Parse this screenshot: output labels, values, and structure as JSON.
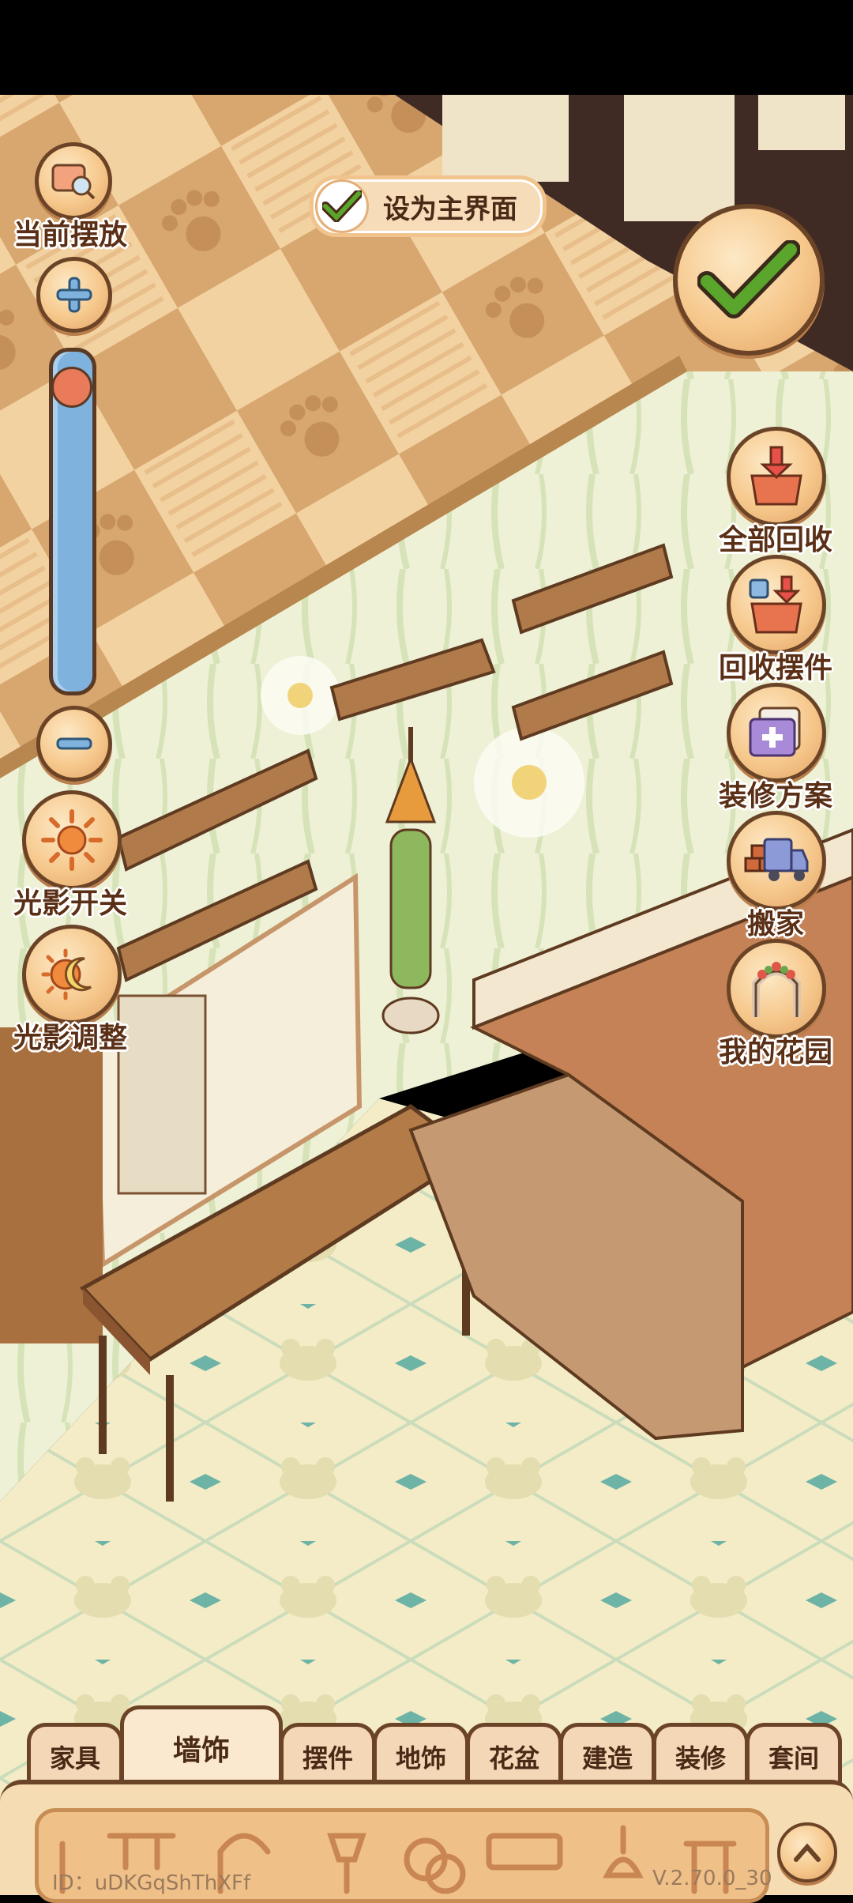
{
  "left_controls": {
    "current_placement_label": "当前摆放",
    "light_toggle_label": "光影开关",
    "light_adjust_label": "光影调整",
    "zoom_level": 0.95
  },
  "set_main_label": "设为主界面",
  "right_controls": {
    "recycle_all_label": "全部回收",
    "recycle_decor_label": "回收摆件",
    "renovation_plan_label": "装修方案",
    "move_label": "搬家",
    "my_garden_label": "我的花园"
  },
  "tabs": [
    {
      "label": "家具",
      "active": false
    },
    {
      "label": "墙饰",
      "active": true
    },
    {
      "label": "摆件",
      "active": false
    },
    {
      "label": "地饰",
      "active": false
    },
    {
      "label": "花盆",
      "active": false
    },
    {
      "label": "建造",
      "active": false
    },
    {
      "label": "装修",
      "active": false
    },
    {
      "label": "套间",
      "active": false
    }
  ],
  "footer": {
    "id_text": "ID：uDKGqShThXFf",
    "version": "V.2.70.0_30"
  },
  "colors": {
    "accent_green": "#5aa62c",
    "outline_brown": "#6b4326",
    "button_orange": "#f6c88c",
    "slider_blue": "#7fb2dd"
  }
}
